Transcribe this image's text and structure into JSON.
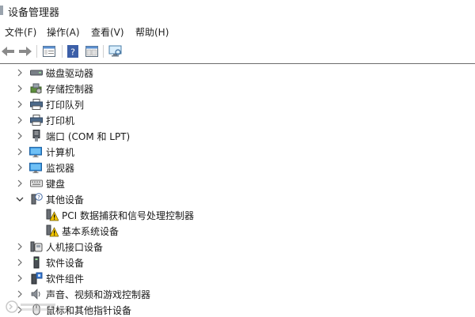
{
  "window": {
    "title": "设备管理器"
  },
  "menu": [
    {
      "label": "文件(F)"
    },
    {
      "label": "操作(A)"
    },
    {
      "label": "查看(V)"
    },
    {
      "label": "帮助(H)"
    }
  ],
  "toolbar": {
    "icons": [
      "back-arrow-icon",
      "forward-arrow-icon",
      "properties-icon",
      "help-icon",
      "console-view-icon",
      "monitor-scan-icon"
    ]
  },
  "tree": {
    "items": [
      {
        "label": "磁盘驱动器",
        "icon": "disk-drive-icon",
        "expanded": false
      },
      {
        "label": "存储控制器",
        "icon": "storage-controller-icon",
        "expanded": false
      },
      {
        "label": "打印队列",
        "icon": "printer-queue-icon",
        "expanded": false
      },
      {
        "label": "打印机",
        "icon": "printer-icon",
        "expanded": false
      },
      {
        "label": "端口 (COM 和 LPT)",
        "icon": "port-icon",
        "expanded": false
      },
      {
        "label": "计算机",
        "icon": "computer-icon",
        "expanded": false
      },
      {
        "label": "监视器",
        "icon": "monitor-icon",
        "expanded": false
      },
      {
        "label": "键盘",
        "icon": "keyboard-icon",
        "expanded": false
      },
      {
        "label": "其他设备",
        "icon": "unknown-device-icon",
        "expanded": true
      },
      {
        "label": "PCI 数据捕获和信号处理控制器",
        "icon": "warning-device-icon",
        "child": true
      },
      {
        "label": "基本系统设备",
        "icon": "warning-device-icon",
        "child": true
      },
      {
        "label": "人机接口设备",
        "icon": "hid-icon",
        "expanded": false
      },
      {
        "label": "软件设备",
        "icon": "software-device-icon",
        "expanded": false
      },
      {
        "label": "软件组件",
        "icon": "software-component-icon",
        "expanded": false
      },
      {
        "label": "声音、视频和游戏控制器",
        "icon": "sound-icon",
        "expanded": false
      },
      {
        "label": "鼠标和其他指针设备",
        "icon": "mouse-icon",
        "expanded": false
      }
    ]
  },
  "colors": {
    "accent_blue": "#3a7bd5",
    "warning_yellow": "#f2c500"
  }
}
